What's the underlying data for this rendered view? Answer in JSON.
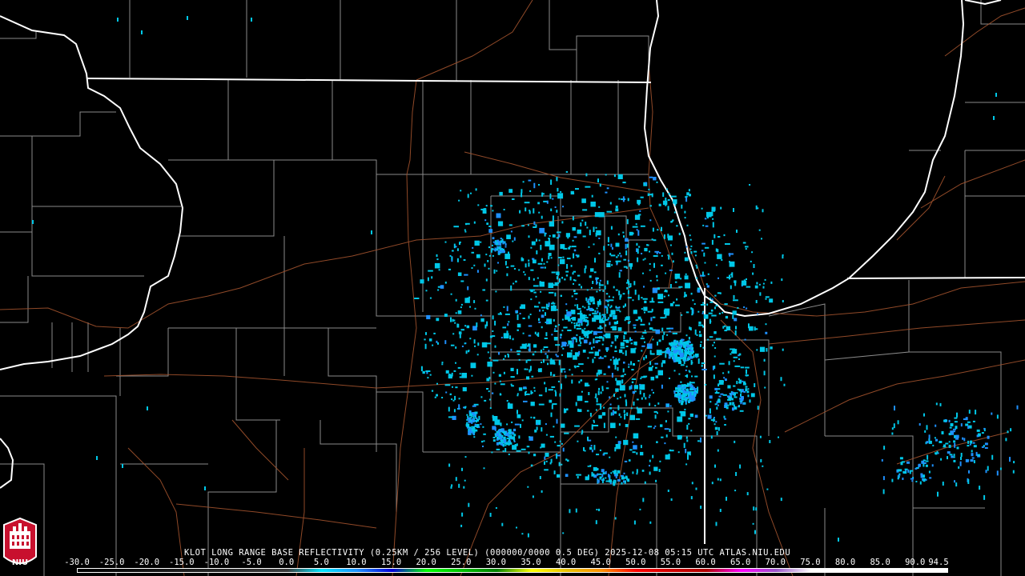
{
  "caption": "KLOT LONG RANGE BASE REFLECTIVITY (0.25KM / 256 LEVEL) (000000/0000 0.5 DEG) 2025-12-08 05:15 UTC  ATLAS.NIU.EDU",
  "logo_text": "NIU",
  "colors": {
    "background": "#000000",
    "state_border": "#ffffff",
    "county_border": "#8a8a8a",
    "highway": "#a0522d",
    "echo_light": "#00c8e8",
    "echo_medium": "#1e90ff",
    "logo_red": "#c8102e"
  },
  "colorbar": {
    "ticks": [
      "-30.0",
      "-25.0",
      "-20.0",
      "-15.0",
      "-10.0",
      "-5.0",
      "0.0",
      "5.0",
      "10.0",
      "15.0",
      "20.0",
      "25.0",
      "30.0",
      "35.0",
      "40.0",
      "45.0",
      "50.0",
      "55.0",
      "60.0",
      "65.0",
      "70.0",
      "75.0",
      "80.0",
      "85.0",
      "90.0",
      "94.5"
    ],
    "range": [
      -30,
      94.5
    ],
    "stops": [
      {
        "dbz": -30,
        "color": "#000000"
      },
      {
        "dbz": 0,
        "color": "#3a3a3a"
      },
      {
        "dbz": 5,
        "color": "#00e5ff"
      },
      {
        "dbz": 10,
        "color": "#1e90ff"
      },
      {
        "dbz": 15,
        "color": "#0000d8"
      },
      {
        "dbz": 20,
        "color": "#00ff00"
      },
      {
        "dbz": 25,
        "color": "#00c000"
      },
      {
        "dbz": 30,
        "color": "#008000"
      },
      {
        "dbz": 35,
        "color": "#ffff00"
      },
      {
        "dbz": 40,
        "color": "#e8c000"
      },
      {
        "dbz": 45,
        "color": "#ff9000"
      },
      {
        "dbz": 50,
        "color": "#ff0000"
      },
      {
        "dbz": 55,
        "color": "#d00000"
      },
      {
        "dbz": 60,
        "color": "#b00000"
      },
      {
        "dbz": 65,
        "color": "#ff00ff"
      },
      {
        "dbz": 70,
        "color": "#9955c9"
      },
      {
        "dbz": 75,
        "color": "#ffffff"
      },
      {
        "dbz": 94.5,
        "color": "#ffffff"
      }
    ]
  }
}
